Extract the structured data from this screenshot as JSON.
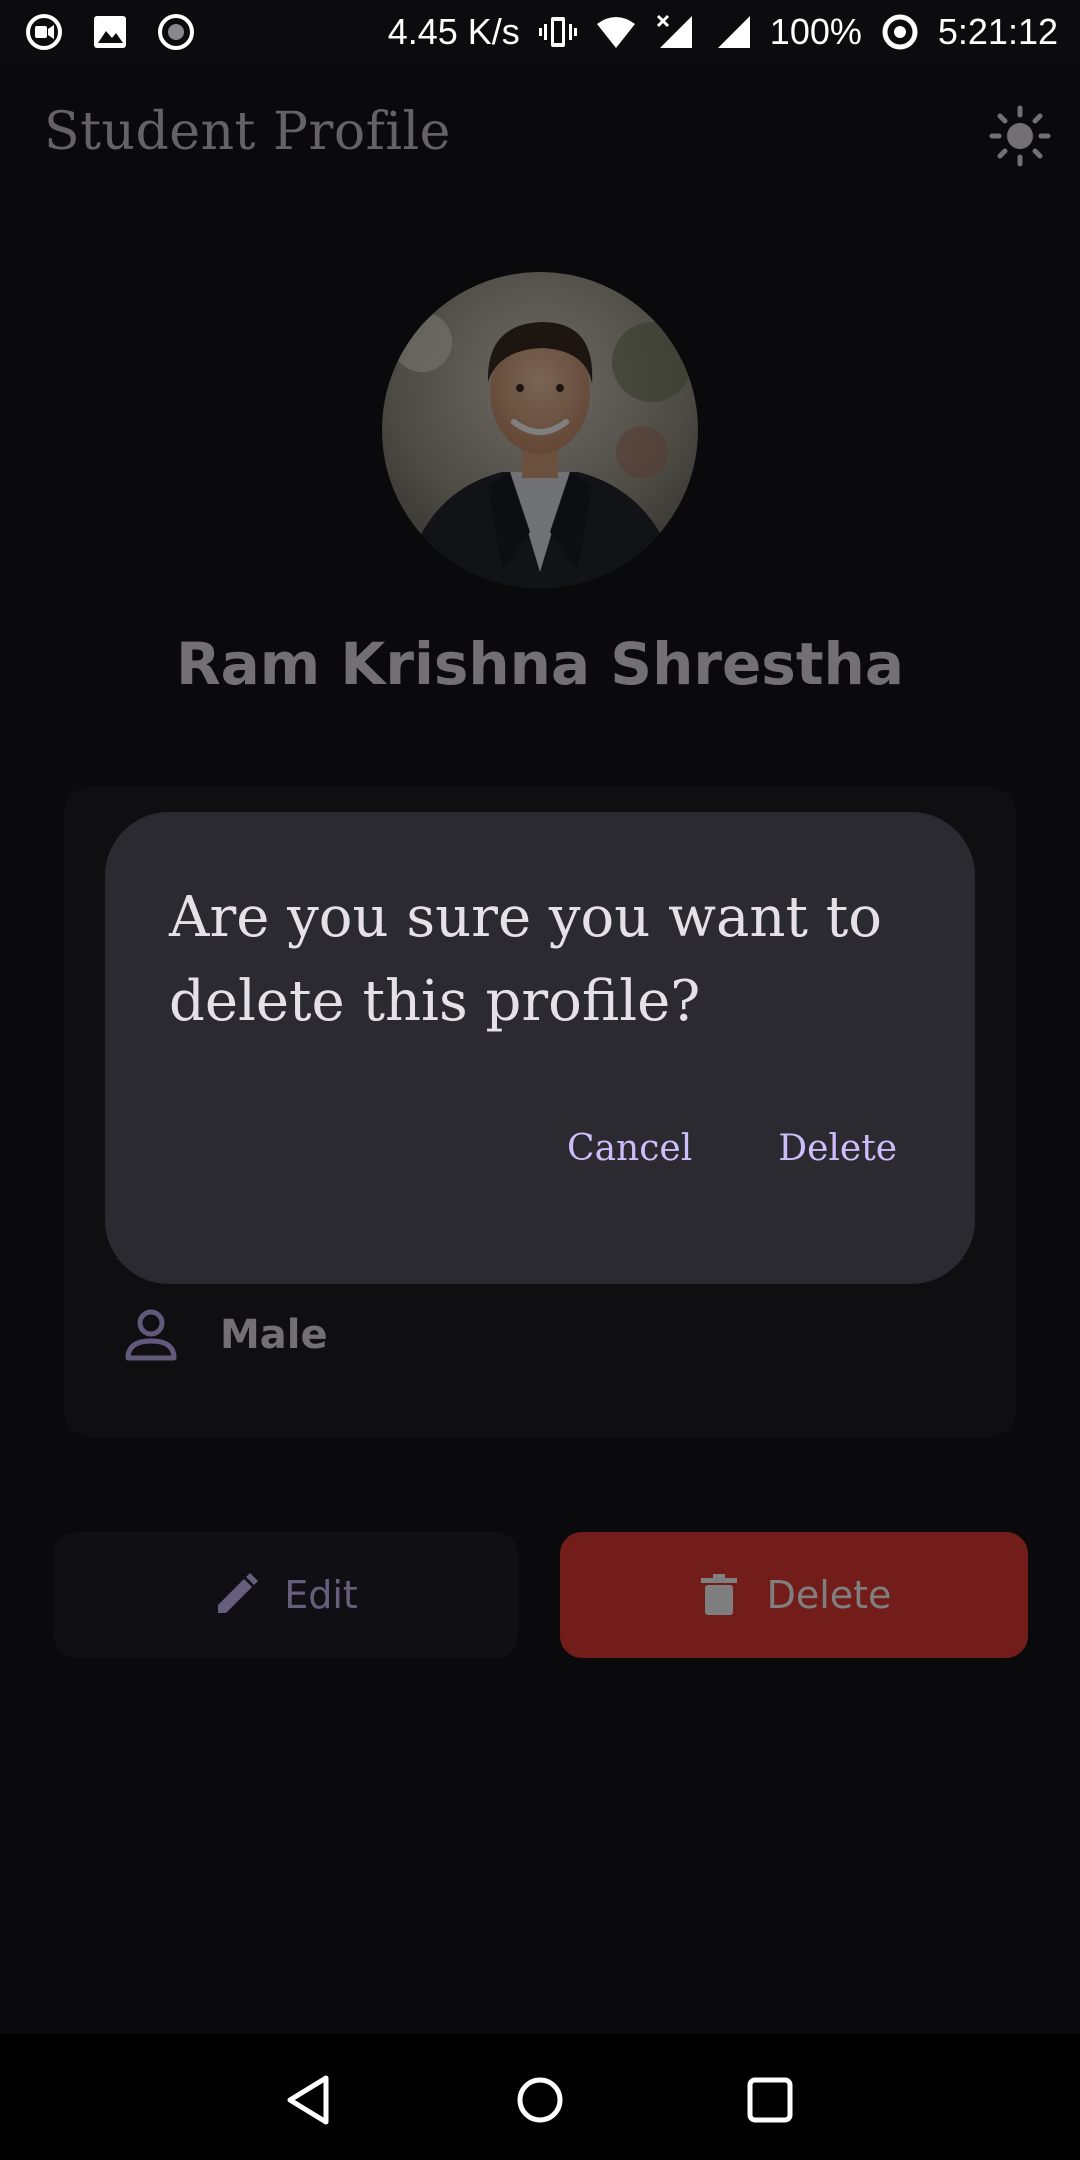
{
  "status_bar": {
    "net_speed": "4.45 K/s",
    "battery": "100%",
    "time": "5:21:12",
    "icons": [
      "video-camera-icon",
      "image-icon",
      "record-icon",
      "vibrate-icon",
      "wifi-icon",
      "signal-no-service-icon",
      "signal-icon",
      "data-saver-icon"
    ]
  },
  "app_bar": {
    "title": "Student Profile",
    "theme_icon": "sun-icon"
  },
  "profile": {
    "name": "Ram Krishna Shrestha",
    "avatar_icon": "profile-photo",
    "gender": "Male",
    "gender_icon": "person-icon"
  },
  "actions": {
    "edit_label": "Edit",
    "edit_icon": "pencil-icon",
    "delete_label": "Delete",
    "delete_icon": "trash-icon"
  },
  "dialog": {
    "message": "Are you sure you want to delete this profile?",
    "cancel_label": "Cancel",
    "confirm_label": "Delete"
  },
  "colors": {
    "accent": "#cdbdfb",
    "danger": "#e53a33",
    "surface": "#141318",
    "dialog": "#2b2a30"
  },
  "nav_bar": {
    "icons": [
      "back-icon",
      "home-icon",
      "recents-icon"
    ]
  }
}
